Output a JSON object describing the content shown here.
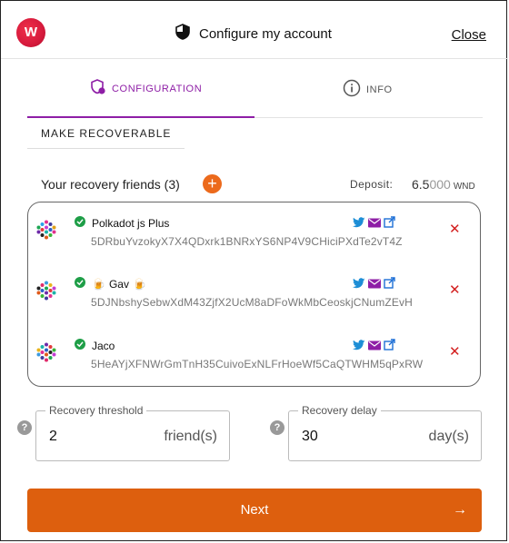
{
  "header": {
    "logo_letter": "W",
    "title": "Configure my account",
    "close_label": "Close"
  },
  "tabs": [
    {
      "label": "CONFIGURATION",
      "active": true
    },
    {
      "label": "INFO",
      "active": false
    }
  ],
  "section": {
    "label": "MAKE RECOVERABLE"
  },
  "friends": {
    "title": "Your recovery friends (3)",
    "add_icon": "plus",
    "deposit_label": "Deposit:",
    "deposit_int": "6.5",
    "deposit_dec": "000",
    "deposit_unit": "WND",
    "items": [
      {
        "name": "Polkadot js Plus",
        "address": "5DRbuYvzokyX7X4QDxrk1BNRxYS6NP4V9CHiciPXdTe2vT4Z",
        "emoji_pre": "",
        "emoji_post": ""
      },
      {
        "name": "Gav",
        "address": "5DJNbshySebwXdM43ZjfX2UcM8aDFoWkMbCeoskjCNumZEvH",
        "emoji_pre": "🍺",
        "emoji_post": "🍺"
      },
      {
        "name": "Jaco",
        "address": "5HeAYjXFNWrGmTnH35CuivoExNLFrHoeWf5CaQTWHM5qPxRW",
        "emoji_pre": "",
        "emoji_post": ""
      }
    ]
  },
  "threshold": {
    "legend": "Recovery threshold",
    "value": "2",
    "unit": "friend(s)"
  },
  "delay": {
    "legend": "Recovery delay",
    "value": "30",
    "unit": "day(s)"
  },
  "next": {
    "label": "Next",
    "arrow": "→"
  },
  "colors": {
    "accent": "#8e1ea6",
    "primary_button": "#dd5f0e",
    "add_button": "#ec6a1c",
    "remove": "#d32020",
    "verified": "#1e9e47"
  }
}
